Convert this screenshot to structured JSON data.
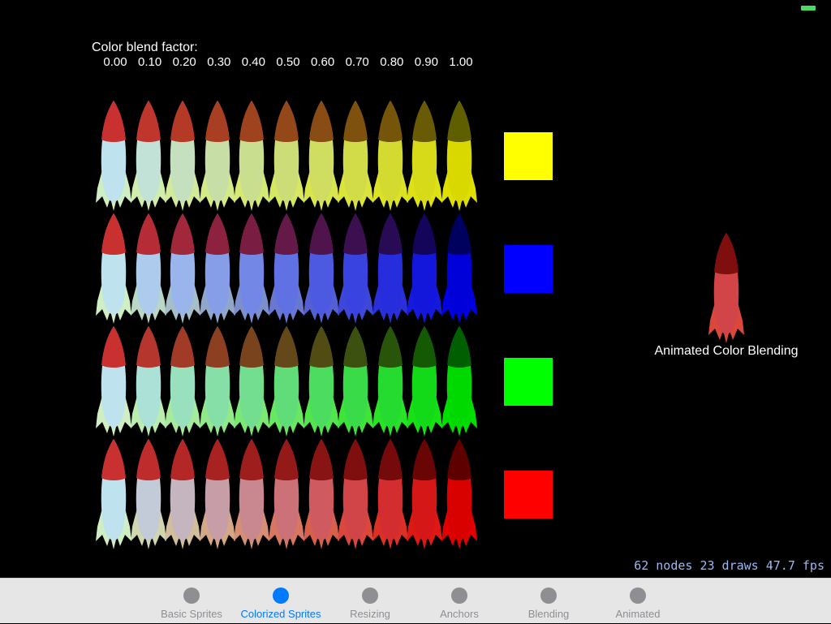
{
  "status": {
    "battery_color": "#4cd964"
  },
  "scene": {
    "blend_label": "Color blend factor:",
    "factors": [
      "0.00",
      "0.10",
      "0.20",
      "0.30",
      "0.40",
      "0.50",
      "0.60",
      "0.70",
      "0.80",
      "0.90",
      "1.00"
    ],
    "base_rocket": {
      "nose": "#c93131",
      "body": "#bfe2ef",
      "fins": "#cfeec1"
    },
    "rows": [
      {
        "color_name": "yellow",
        "color": "#ffff00"
      },
      {
        "color_name": "blue",
        "color": "#0000ff"
      },
      {
        "color_name": "green",
        "color": "#00ff00"
      },
      {
        "color_name": "red",
        "color": "#ff0000"
      }
    ],
    "animated": {
      "label": "Animated Color Blending",
      "tint": "#ff0000",
      "factor": 0.5
    },
    "stats": "62 nodes 23 draws 47.7 fps"
  },
  "tabbar": {
    "selected_color": "#007aff",
    "unselected_color": "#8e8e93",
    "tabs": [
      {
        "label": "Basic Sprites",
        "selected": false
      },
      {
        "label": "Colorized Sprites",
        "selected": true
      },
      {
        "label": "Resizing",
        "selected": false
      },
      {
        "label": "Anchors",
        "selected": false
      },
      {
        "label": "Blending",
        "selected": false
      },
      {
        "label": "Animated",
        "selected": false
      }
    ]
  }
}
